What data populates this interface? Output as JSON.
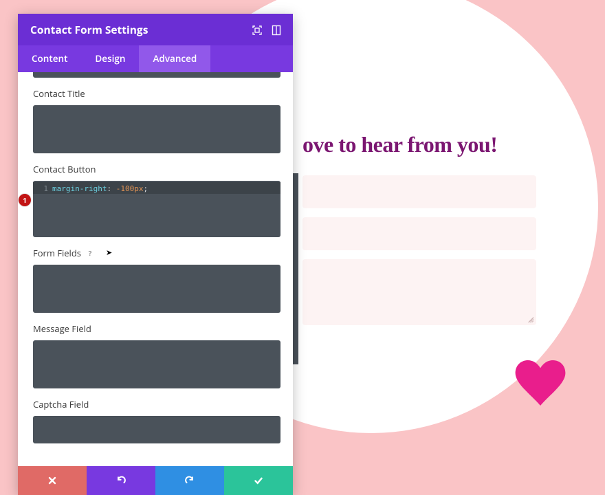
{
  "colors": {
    "background": "#fac4c6",
    "headerPurple": "#6b2ed4",
    "tabPurple": "#7839e0",
    "activeTab": "#9158ea",
    "codeBg": "#4a525a",
    "heroText": "#7b1671",
    "heart": "#e91e8c",
    "cancel": "#e06a66",
    "undo": "#7839e0",
    "redo": "#2f8fe3",
    "save": "#2bc49a"
  },
  "panel": {
    "title": "Contact Form Settings"
  },
  "tabs": {
    "content": "Content",
    "design": "Design",
    "advanced": "Advanced",
    "active": "advanced"
  },
  "sections": {
    "contactTitle": {
      "label": "Contact Title",
      "code": ""
    },
    "contactButton": {
      "label": "Contact Button",
      "code": {
        "line": 1,
        "property": "margin-right",
        "value": "-100px"
      },
      "marker": "1"
    },
    "formFields": {
      "label": "Form Fields",
      "help": "?",
      "code": ""
    },
    "messageField": {
      "label": "Message Field",
      "code": ""
    },
    "captchaField": {
      "label": "Captcha Field",
      "code": ""
    }
  },
  "hero": {
    "visibleText": "ove to hear from you!"
  }
}
